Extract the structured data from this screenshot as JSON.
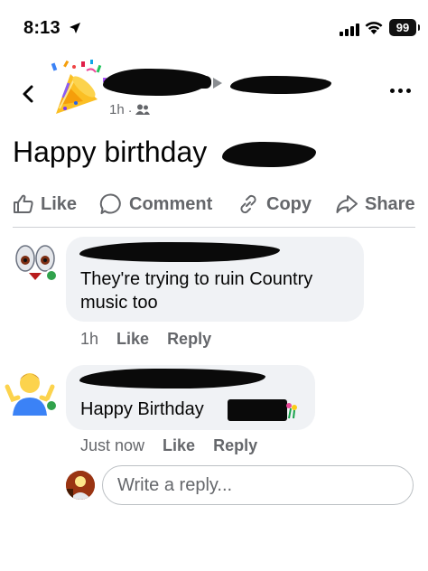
{
  "status_bar": {
    "time": "8:13",
    "battery": "99",
    "icons": [
      "location-arrow-icon",
      "cellular-signal-icon",
      "wifi-icon",
      "battery-icon"
    ]
  },
  "post": {
    "timestamp": "1h",
    "separator": "·",
    "audience_icon": "friends-icon",
    "text": "Happy birthday"
  },
  "actions": {
    "like": "Like",
    "comment": "Comment",
    "copy": "Copy",
    "share": "Share"
  },
  "comments": [
    {
      "text_line1": "They're trying to ruin Country",
      "text_line2": "music too",
      "time": "1h",
      "like": "Like",
      "reply": "Reply"
    },
    {
      "text": "Happy Birthday",
      "time": "Just now",
      "like": "Like",
      "reply": "Reply"
    }
  ],
  "reply_box": {
    "placeholder": "Write a reply..."
  },
  "colors": {
    "secondary_text": "#65676b",
    "bubble_bg": "#f0f2f5",
    "online_green": "#31a24c",
    "divider": "#ced0d4"
  }
}
